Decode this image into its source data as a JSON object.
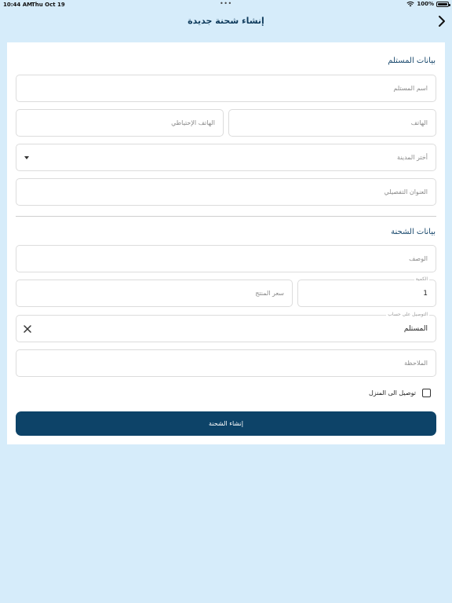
{
  "status_bar": {
    "time": "10:44 AM",
    "date": "Thu Oct 19",
    "battery": "100%"
  },
  "nav": {
    "title": "إنشاء شحنة جديدة"
  },
  "recipient": {
    "section_title": "بيانات المستلم",
    "name_placeholder": "اسم المستلم",
    "phone_placeholder": "الهاتف",
    "backup_phone_placeholder": "الهاتف الإحتياطي",
    "city_placeholder": "أختر المدينة",
    "address_placeholder": "العنوان التفصيلي"
  },
  "shipment": {
    "section_title": "بيانات الشحنة",
    "description_placeholder": "الوصف",
    "quantity_label": "الكمية",
    "quantity_value": "1",
    "price_placeholder": "سعر المنتج",
    "delivery_account_label": "التوصيل على حساب",
    "delivery_account_value": "المستلم",
    "notes_placeholder": "الملاحظة",
    "home_delivery_label": "توصيل الى المنزل",
    "home_delivery_checked": false
  },
  "submit_label": "إنشاء الشحنة",
  "colors": {
    "background": "#d6ecfa",
    "primary": "#0d4368",
    "section_title": "#1b4a6e"
  }
}
